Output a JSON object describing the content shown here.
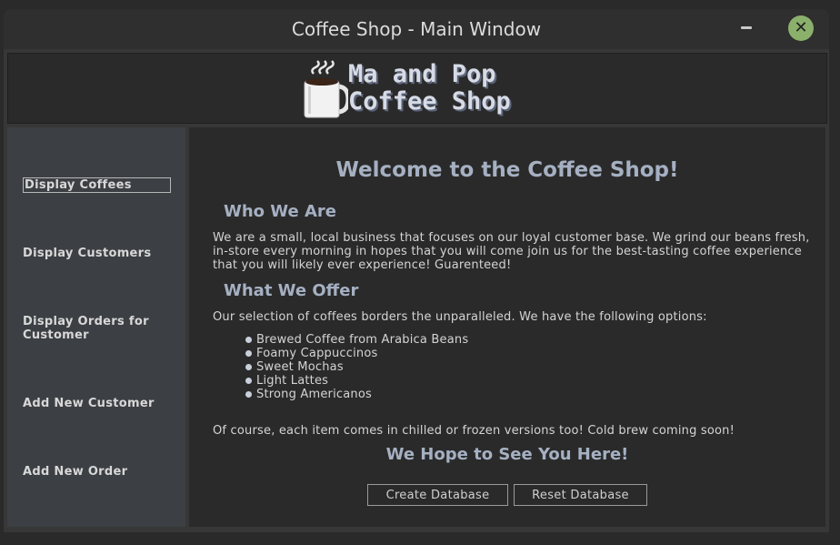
{
  "window": {
    "title": "Coffee Shop - Main Window",
    "minimize_icon": "minimize-icon",
    "close_icon": "close-icon",
    "close_color": "#8bb06c"
  },
  "header": {
    "logo_line1": "Ma and Pop",
    "logo_line2": "Coffee Shop",
    "logo_icon": "coffee-mug-icon"
  },
  "sidebar": {
    "items": [
      {
        "label": "Display Coffees",
        "selected": true
      },
      {
        "label": "Display Customers"
      },
      {
        "label": "Display Orders for Customer"
      },
      {
        "label": "Add New Customer"
      },
      {
        "label": "Add New Order"
      }
    ]
  },
  "main": {
    "welcome": "Welcome to the Coffee Shop!",
    "who_heading": "Who We Are",
    "who_text": "We are a small, local business that focuses on our loyal customer base. We grind our beans fresh, in-store every morning in hopes that you will come join us for the best-tasting coffee experience that you will likely ever experience! Guarenteed!",
    "offer_heading": "What We Offer",
    "offer_intro": "Our selection of coffees borders the unparalleled. We have the following options:",
    "offerings": [
      "Brewed Coffee from Arabica Beans",
      "Foamy Cappuccinos",
      "Sweet Mochas",
      "Light Lattes",
      "Strong Americanos"
    ],
    "versions_note": "Of course, each item comes in chilled or frozen versions too! Cold brew coming soon!",
    "closing": "We Hope to See You Here!",
    "create_db_label": "Create Database",
    "reset_db_label": "Reset Database"
  }
}
